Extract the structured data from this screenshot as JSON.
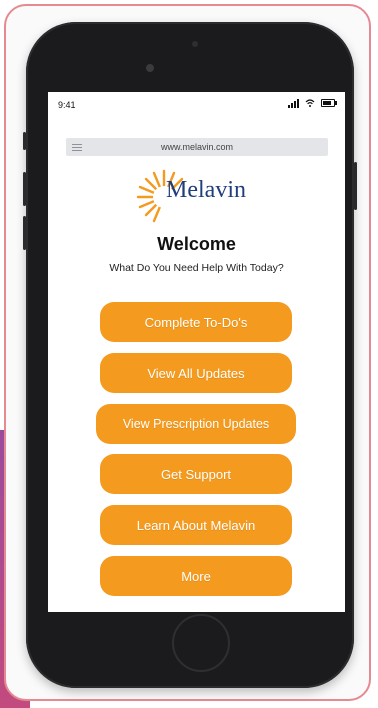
{
  "status": {
    "time": "9:41"
  },
  "browser": {
    "url": "www.melavin.com"
  },
  "brand": {
    "name": "Melavin"
  },
  "page": {
    "welcome": "Welcome",
    "subtitle": "What Do You Need Help With Today?"
  },
  "buttons": [
    {
      "label": "Complete To-Do's"
    },
    {
      "label": "View All Updates"
    },
    {
      "label": "View Prescription Updates"
    },
    {
      "label": "Get Support"
    },
    {
      "label": "Learn About Melavin"
    },
    {
      "label": "More"
    }
  ],
  "colors": {
    "accent": "#f39a1f",
    "brand_text": "#203e7c",
    "frame_border": "#e58a92",
    "phone_body": "#1b1b1d"
  },
  "icons": [
    "hamburger-menu-icon",
    "signal-icon",
    "wifi-icon",
    "battery-icon",
    "sun-logo-icon"
  ]
}
